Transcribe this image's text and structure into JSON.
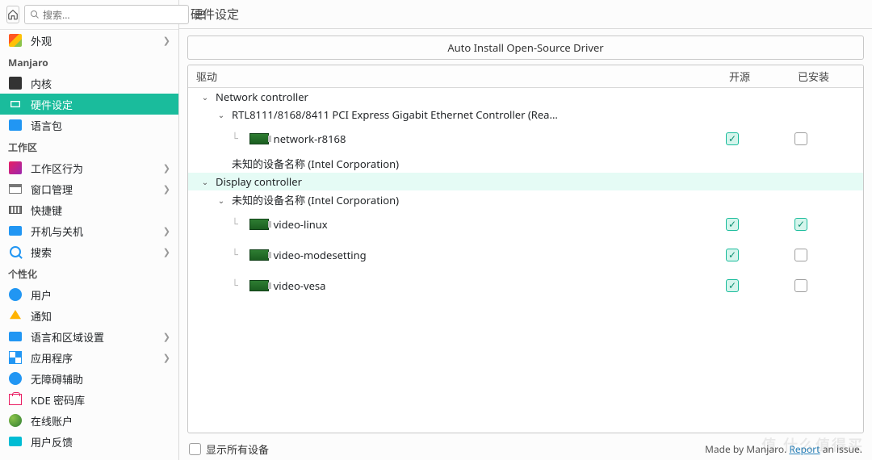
{
  "sidebar": {
    "search_placeholder": "搜索...",
    "groups": [
      {
        "title": null,
        "items": [
          {
            "id": "appearance",
            "label": "外观",
            "chev": true
          }
        ]
      },
      {
        "title": "Manjaro",
        "items": [
          {
            "id": "kernel",
            "label": "内核"
          },
          {
            "id": "hardware",
            "label": "硬件设定",
            "active": true
          },
          {
            "id": "lang",
            "label": "语言包"
          }
        ]
      },
      {
        "title": "工作区",
        "items": [
          {
            "id": "workspace",
            "label": "工作区行为",
            "chev": true
          },
          {
            "id": "window",
            "label": "窗口管理",
            "chev": true
          },
          {
            "id": "shortcut",
            "label": "快捷键"
          },
          {
            "id": "power",
            "label": "开机与关机",
            "chev": true
          },
          {
            "id": "search",
            "label": "搜索",
            "chev": true
          }
        ]
      },
      {
        "title": "个性化",
        "items": [
          {
            "id": "user",
            "label": "用户"
          },
          {
            "id": "notify",
            "label": "通知"
          },
          {
            "id": "locale",
            "label": "语言和区域设置",
            "chev": true
          },
          {
            "id": "apps",
            "label": "应用程序",
            "chev": true
          },
          {
            "id": "access",
            "label": "无障碍辅助"
          },
          {
            "id": "wallet",
            "label": "KDE 密码库"
          },
          {
            "id": "online",
            "label": "在线账户"
          },
          {
            "id": "feedback",
            "label": "用户反馈"
          }
        ]
      }
    ]
  },
  "header": {
    "title": "硬件设定"
  },
  "auto_install_label": "Auto Install Open-Source Driver",
  "columns": {
    "driver": "驱动",
    "open": "开源",
    "installed": "已安装"
  },
  "tree": [
    {
      "type": "category",
      "label": "Network controller",
      "depth": 0,
      "expander": "v"
    },
    {
      "type": "device",
      "label": "RTL8111/8168/8411 PCI Express Gigabit Ethernet Controller (Rea...",
      "depth": 1,
      "expander": "v"
    },
    {
      "type": "driver",
      "label": "network-r8168",
      "depth": 2,
      "open": true,
      "installed": false
    },
    {
      "type": "device",
      "label": "未知的设备名称 (Intel Corporation)",
      "depth": 1,
      "expander": ""
    },
    {
      "type": "category",
      "label": "Display controller",
      "depth": 0,
      "expander": "v",
      "selected": true
    },
    {
      "type": "device",
      "label": "未知的设备名称 (Intel Corporation)",
      "depth": 1,
      "expander": "v"
    },
    {
      "type": "driver",
      "label": "video-linux",
      "depth": 2,
      "open": true,
      "installed": true
    },
    {
      "type": "driver",
      "label": "video-modesetting",
      "depth": 2,
      "open": true,
      "installed": false
    },
    {
      "type": "driver",
      "label": "video-vesa",
      "depth": 2,
      "open": true,
      "installed": false
    }
  ],
  "footer": {
    "show_all": "显示所有设备",
    "made_by_pre": "Made by Manjaro. ",
    "report": "Report",
    "made_by_post": " an issue."
  },
  "watermark": "值   什么值得买"
}
